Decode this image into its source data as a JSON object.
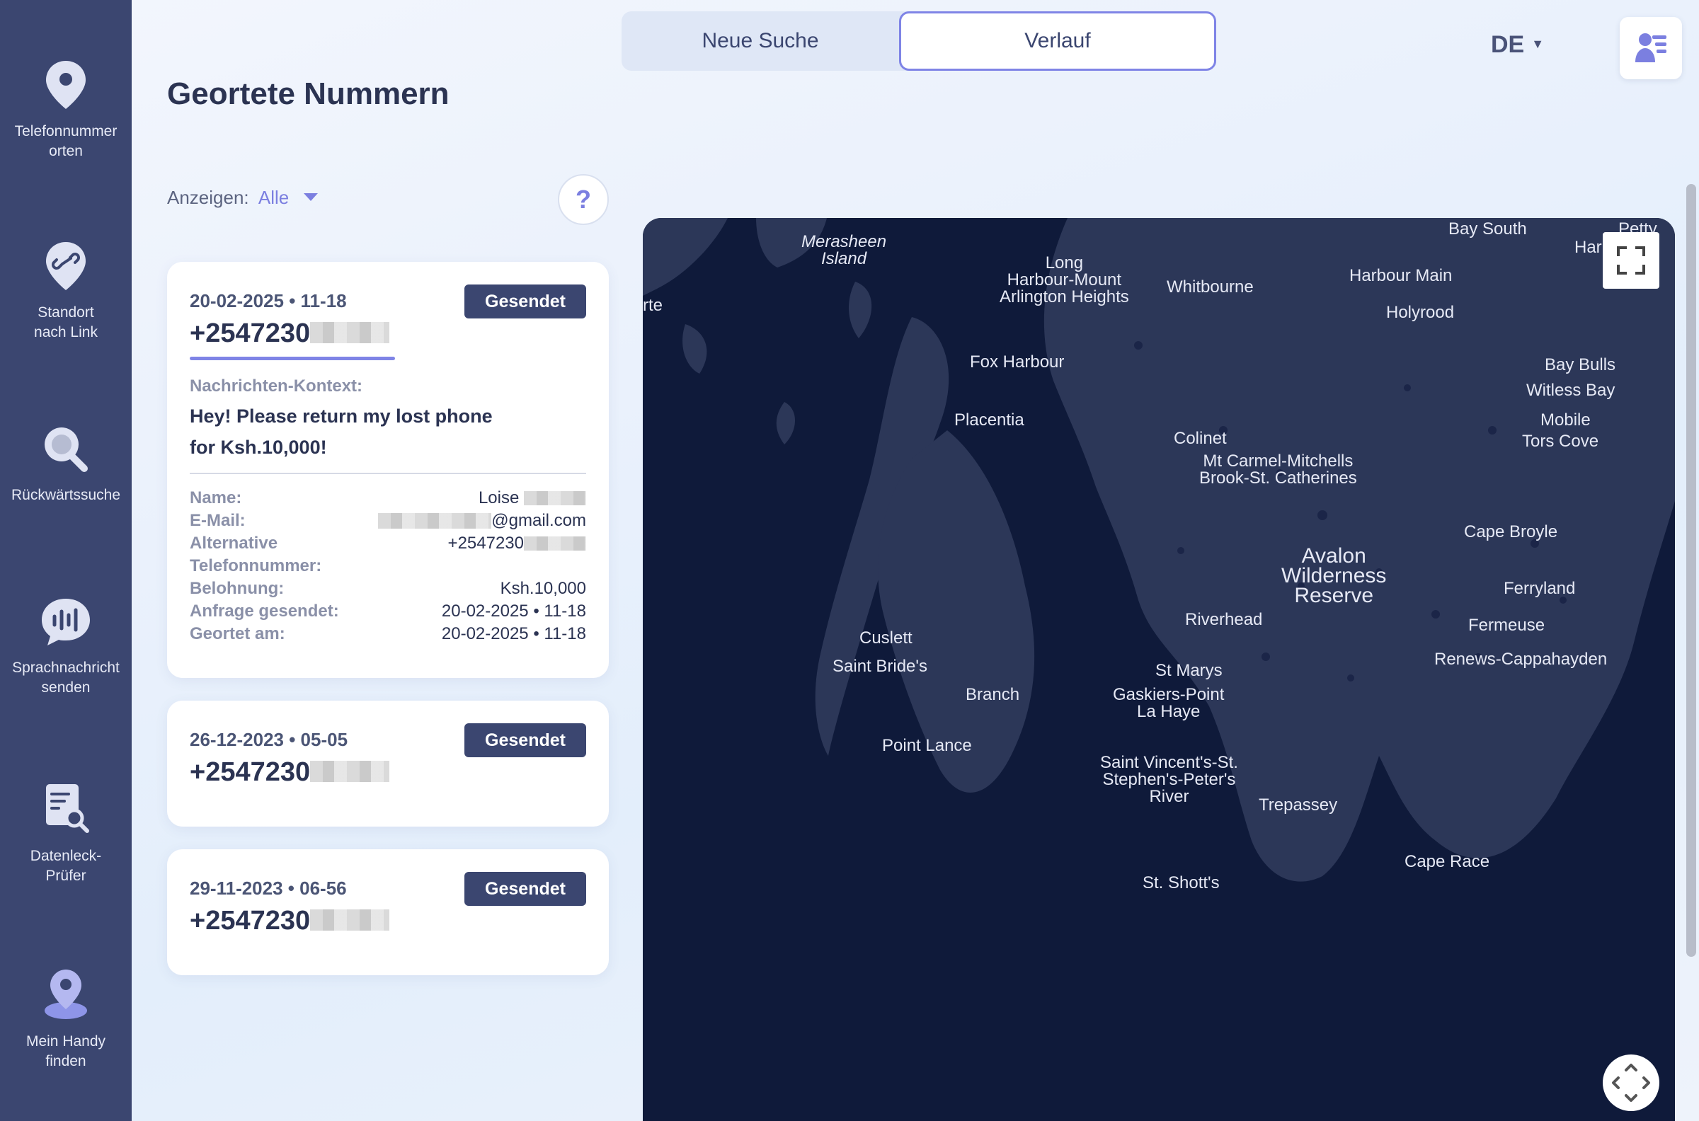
{
  "sidebar": {
    "items": [
      {
        "label": "Telefonnummer\norten",
        "icon": "location-pin-icon"
      },
      {
        "label": "Standort\nnach Link",
        "icon": "link-pin-icon"
      },
      {
        "label": "Rückwärtssuche",
        "icon": "magnifier-icon"
      },
      {
        "label": "Sprachnachricht\nsenden",
        "icon": "voice-message-icon"
      },
      {
        "label": "Datenleck-\nPrüfer",
        "icon": "data-leak-icon"
      },
      {
        "label": "Mein Handy\nfinden",
        "icon": "find-phone-icon"
      }
    ]
  },
  "header": {
    "tabs": {
      "new_search": "Neue Suche",
      "history": "Verlauf"
    },
    "language": "DE"
  },
  "page": {
    "title": "Geortete Nummern",
    "filter_label": "Anzeigen:",
    "filter_value": "Alle",
    "help": "?"
  },
  "cards": [
    {
      "date": "20-02-2025 • 11-18",
      "status": "Gesendet",
      "phone": "+2547230",
      "context_label": "Nachrichten-Kontext:",
      "context_text": "Hey! Please return my lost phone for Ksh.10,000!",
      "details": {
        "name_label": "Name:",
        "name_value": "Loise",
        "email_label": "E-Mail:",
        "email_value": "@gmail.com",
        "alt_label": "Alternative Telefonnummer:",
        "alt_value": "+2547230",
        "reward_label": "Belohnung:",
        "reward_value": "Ksh.10,000",
        "sent_label": "Anfrage gesendet:",
        "sent_value": "20-02-2025 • 11-18",
        "located_label": "Geortet am:",
        "located_value": "20-02-2025 • 11-18"
      }
    },
    {
      "date": "26-12-2023 • 05-05",
      "status": "Gesendet",
      "phone": "+2547230"
    },
    {
      "date": "29-11-2023 • 06-56",
      "status": "Gesendet",
      "phone": "+2547230"
    }
  ],
  "map": {
    "places": [
      "Merasheen\nIsland",
      "Long\nHarbour-Mount\nArlington Heights",
      "Whitbourne",
      "Harbour Main",
      "Bay South",
      "Holyrood",
      "rte",
      "Fox Harbour",
      "Placentia",
      "Colinet",
      "Mt Carmel-Mitchells\nBrook-St. Catherines",
      "Bay Bulls",
      "Witless Bay",
      "Mobile",
      "Tors Cove",
      "Cape Broyle",
      "Avalon\nWilderness\nReserve",
      "Ferryland",
      "Riverhead",
      "Fermeuse",
      "Renews-Cappahayden",
      "Cuslett",
      "Saint Bride's",
      "St Marys",
      "Branch",
      "Gaskiers-Point\nLa Haye",
      "Point Lance",
      "Saint Vincent's-St.\nStephen's-Peter's\nRiver",
      "Trepassey",
      "Cape Race",
      "St. Shott's",
      "Petty",
      "Har"
    ]
  }
}
